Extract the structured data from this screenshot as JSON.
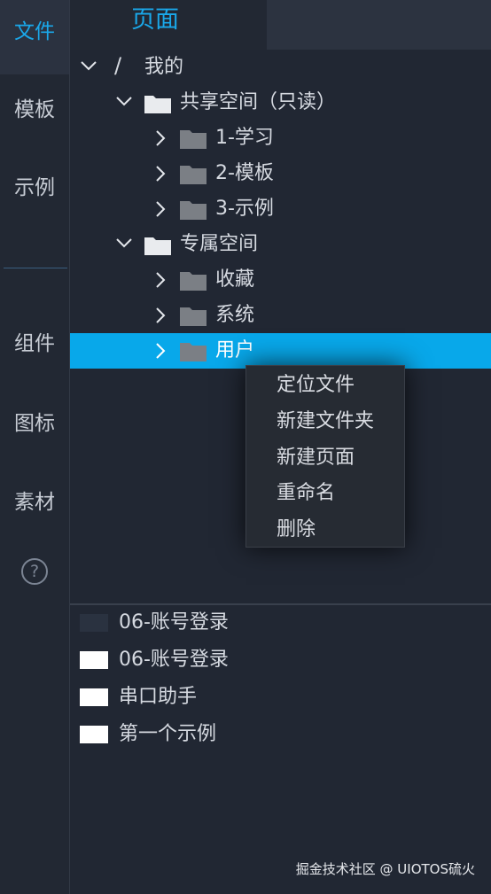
{
  "sidebar": {
    "items": [
      {
        "label": "文件"
      },
      {
        "label": "模板"
      },
      {
        "label": "示例"
      },
      {
        "label": "组件"
      },
      {
        "label": "图标"
      },
      {
        "label": "素材"
      }
    ],
    "help": "?"
  },
  "tabs": {
    "page": "页面"
  },
  "tree": {
    "root": {
      "label": "我的",
      "separator": "/"
    },
    "shared": {
      "label": "共享空间（只读）"
    },
    "shared_children": [
      {
        "label": "1-学习"
      },
      {
        "label": "2-模板"
      },
      {
        "label": "3-示例"
      }
    ],
    "private": {
      "label": "专属空间"
    },
    "private_children": [
      {
        "label": "收藏"
      },
      {
        "label": "系统"
      },
      {
        "label": "用户"
      }
    ]
  },
  "context_menu": {
    "items": [
      {
        "label": "定位文件"
      },
      {
        "label": "新建文件夹"
      },
      {
        "label": "新建页面"
      },
      {
        "label": "重命名"
      },
      {
        "label": "删除"
      }
    ]
  },
  "files": [
    {
      "label": "06-账号登录"
    },
    {
      "label": "06-账号登录"
    },
    {
      "label": "串口助手"
    },
    {
      "label": "第一个示例"
    }
  ],
  "watermark": "掘金技术社区 @ UIOTOS硫火",
  "colors": {
    "accent": "#1aa8ea",
    "selection": "#08a8ea",
    "background": "#212733"
  }
}
